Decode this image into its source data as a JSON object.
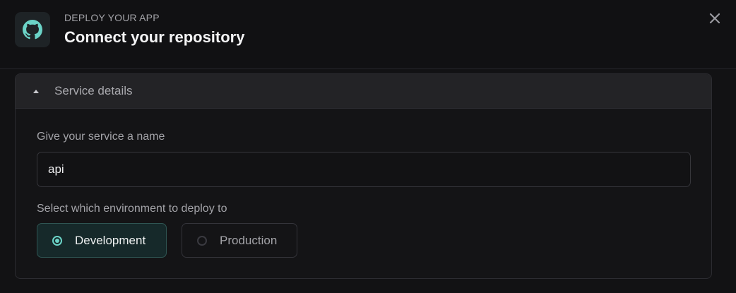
{
  "header": {
    "eyebrow": "DEPLOY YOUR APP",
    "title": "Connect your repository",
    "logo_icon": "github-icon",
    "close_icon": "close-icon"
  },
  "panel": {
    "title": "Service details",
    "expanded": true
  },
  "service_name": {
    "label": "Give your service a name",
    "value": "api"
  },
  "environment": {
    "label": "Select which environment to deploy to",
    "options": [
      {
        "label": "Development",
        "selected": true
      },
      {
        "label": "Production",
        "selected": false
      }
    ]
  },
  "colors": {
    "accent": "#6bd3c7",
    "background": "#121214"
  }
}
